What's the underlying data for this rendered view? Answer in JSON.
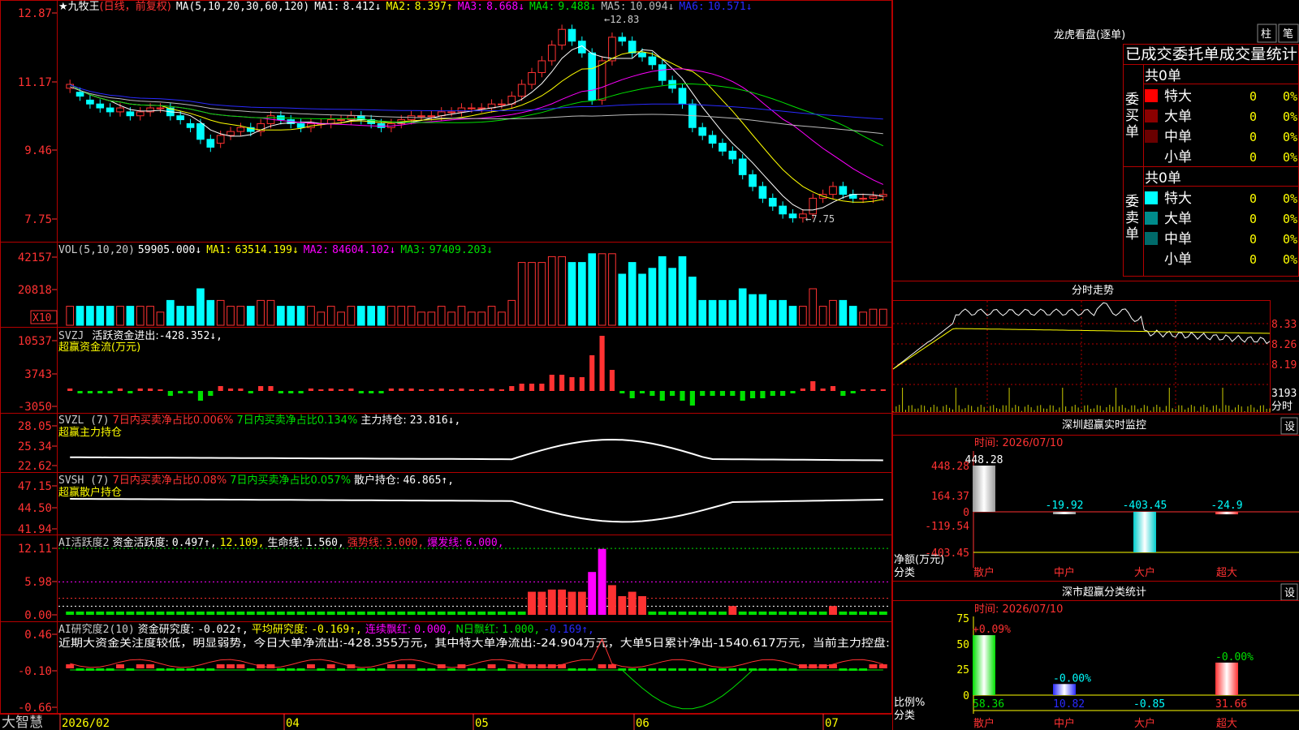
{
  "colors": {
    "up": "#ff3232",
    "down": "#00ffff",
    "green": "#00e000",
    "yellow": "#ffff00",
    "white": "#ffffff",
    "magenta": "#ff00ff",
    "blue": "#2a2aff",
    "grid": "#b40000",
    "axis": "#ff3232",
    "label": "#c0c0c0",
    "flat": "#00cccc"
  },
  "main": {
    "title": "★九牧王",
    "period": "(日线，前复权)",
    "ma_prefix": "MA(5,10,20,30,60,120)",
    "ma": [
      {
        "label": "MA1:",
        "value": "8.412↓",
        "color": "#ffffff"
      },
      {
        "label": "MA2:",
        "value": "8.397↑",
        "color": "#ffff00"
      },
      {
        "label": "MA3:",
        "value": "8.668↓",
        "color": "#ff00ff"
      },
      {
        "label": "MA4:",
        "value": "9.488↓",
        "color": "#00e000"
      },
      {
        "label": "MA5:",
        "value": "10.094↓",
        "color": "#bbbbbb"
      },
      {
        "label": "MA6:",
        "value": "10.571↓",
        "color": "#2a2aff"
      }
    ],
    "y_ticks": [
      "12.87",
      "11.17",
      "9.46",
      "7.75"
    ],
    "y_range": [
      7.4,
      13.1
    ],
    "high_marker": "←12.83",
    "low_marker": "←7.75"
  },
  "vol": {
    "title": "VOL(5,10,20)",
    "value": "59905.000↓",
    "ma": [
      {
        "label": "MA1:",
        "value": "63514.199↓",
        "color": "#ffff00"
      },
      {
        "label": "MA2:",
        "value": "84604.102↓",
        "color": "#ff00ff"
      },
      {
        "label": "MA3:",
        "value": "97409.203↓",
        "color": "#00e000"
      }
    ],
    "y_ticks": [
      "42157",
      "20818"
    ],
    "unit_box": "X10",
    "y_range": [
      0,
      50000
    ]
  },
  "svzj": {
    "title": "SVZJ",
    "label": "活跃资金进出:",
    "value": "-428.352↓,",
    "subtitle": "超赢资金流(万元)",
    "y_ticks": [
      "10537",
      "3743",
      "-3050"
    ],
    "y_range": [
      -3050,
      10537
    ]
  },
  "svzl": {
    "title": "SVZL (7)",
    "t1": "7日内买卖净占比0.006%",
    "t2": "7日内买卖净占比0.134%",
    "t3": "主力持仓:",
    "value": "23.816↓,",
    "subtitle": "超赢主力持仓",
    "y_ticks": [
      "28.05",
      "25.34",
      "22.62"
    ],
    "y_range": [
      22.62,
      28.05
    ]
  },
  "svsh": {
    "title": "SVSH (7)",
    "t1": "7日内买卖净占比0.08%",
    "t2": "7日内买卖净占比0.057%",
    "t3": "散户持仓:",
    "value": "46.865↑,",
    "subtitle": "超赢散户持仓",
    "y_ticks": [
      "47.15",
      "44.50",
      "41.94"
    ],
    "y_range": [
      41.94,
      47.15
    ]
  },
  "ai1": {
    "title": "AI活跃度2",
    "l1": "资金活跃度:",
    "v1": "0.497↑,",
    "v2": "12.109,",
    "l3": "生命线:",
    "v3": "1.560,",
    "l4": "强势线:",
    "v4": "3.000,",
    "l5": "爆发线:",
    "v5": "6.000,",
    "y_ticks": [
      "12.11",
      "5.98",
      "0.00"
    ],
    "y_range": [
      0,
      12.11
    ]
  },
  "ai2": {
    "title": "AI研究度2(10)",
    "l1": "资金研究度:",
    "v1": "-0.022↑,",
    "l2": "平均研究度:",
    "v2": "-0.169↑,",
    "l3": "连续飘红:",
    "v3": "0.000,",
    "l4": "N日飘红:",
    "v4": "1.000,",
    "v5": "-0.169↑,",
    "summary": "近期大资金关注度较低，明显弱势，今日大单净流出:-428.355万元，其中特大单净流出:-24.904万元，大单5日累计净出-1540.617万元，当前主力控盘:",
    "y_ticks": [
      "0.46",
      "-0.10",
      "-0.66"
    ],
    "y_range": [
      -0.66,
      0.46
    ]
  },
  "date_axis": [
    "2026/02",
    "04",
    "05",
    "06",
    "07"
  ],
  "brand": "大智慧",
  "chart_data": [
    {
      "type": "candlestick",
      "title": "★九牧王(日线，前复权)",
      "categories_note": "daily bars 2026/02 - 2026/07",
      "open": [
        11.1,
        11.0,
        10.8,
        10.7,
        10.6,
        10.5,
        10.5,
        10.4,
        10.5,
        10.6,
        10.6,
        10.4,
        10.2,
        10.2,
        9.8,
        9.7,
        9.9,
        10.0,
        10.1,
        10.0,
        10.2,
        10.4,
        10.3,
        10.2,
        10.1,
        10.2,
        10.2,
        10.3,
        10.3,
        10.4,
        10.3,
        10.2,
        10.1,
        10.2,
        10.3,
        10.4,
        10.4,
        10.4,
        10.5,
        10.5,
        10.6,
        10.6,
        10.6,
        10.7,
        10.7,
        10.9,
        11.2,
        11.5,
        11.8,
        12.2,
        12.6,
        12.3,
        12.0,
        10.8,
        11.8,
        12.4,
        12.3,
        12.0,
        11.9,
        11.7,
        11.3,
        11.1,
        10.7,
        10.1,
        9.9,
        9.7,
        9.5,
        9.3,
        8.9,
        8.6,
        8.3,
        8.1,
        7.9,
        7.8,
        7.9,
        8.3,
        8.4,
        8.6,
        8.4,
        8.3,
        8.3,
        8.35
      ],
      "close": [
        11.2,
        10.9,
        10.7,
        10.6,
        10.5,
        10.6,
        10.4,
        10.5,
        10.6,
        10.6,
        10.4,
        10.3,
        10.1,
        9.8,
        9.6,
        9.9,
        10.0,
        10.1,
        10.0,
        10.2,
        10.4,
        10.3,
        10.2,
        10.1,
        10.2,
        10.2,
        10.3,
        10.3,
        10.4,
        10.3,
        10.2,
        10.1,
        10.2,
        10.3,
        10.4,
        10.4,
        10.4,
        10.5,
        10.5,
        10.6,
        10.6,
        10.6,
        10.7,
        10.7,
        10.9,
        11.2,
        11.5,
        11.8,
        12.2,
        12.6,
        12.3,
        12.0,
        10.8,
        11.8,
        12.4,
        12.3,
        12.0,
        11.9,
        11.7,
        11.3,
        11.1,
        10.7,
        10.1,
        9.9,
        9.7,
        9.5,
        9.3,
        8.9,
        8.6,
        8.3,
        8.1,
        7.9,
        7.8,
        7.9,
        8.3,
        8.4,
        8.6,
        8.4,
        8.3,
        8.3,
        8.35,
        8.4
      ]
    }
  ],
  "right": {
    "dragon_title": "龙虎看盘(逐单)",
    "btn_bar": "柱",
    "btn_pen": "笔",
    "tabs": "已成交委托单成交量统计",
    "buy": {
      "side_label": "委买单",
      "total": "共0单",
      "rows": [
        {
          "name": "特大",
          "count": "0",
          "pct": "0%",
          "color": "#ff0000"
        },
        {
          "name": "大单",
          "count": "0",
          "pct": "0%",
          "color": "#8b0000"
        },
        {
          "name": "中单",
          "count": "0",
          "pct": "0%",
          "color": "#6a0000"
        },
        {
          "name": "小单",
          "count": "0",
          "pct": "0%",
          "color": ""
        }
      ]
    },
    "sell": {
      "side_label": "委卖单",
      "total": "共0单",
      "rows": [
        {
          "name": "特大",
          "count": "0",
          "pct": "0%",
          "color": "#00ffff"
        },
        {
          "name": "大单",
          "count": "0",
          "pct": "0%",
          "color": "#008b8b"
        },
        {
          "name": "中单",
          "count": "0",
          "pct": "0%",
          "color": "#006a6a"
        },
        {
          "name": "小单",
          "count": "0",
          "pct": "0%",
          "color": ""
        }
      ]
    },
    "intraday": {
      "title": "分时走势",
      "y_ticks": [
        "8.33",
        "8.26",
        "8.19"
      ],
      "vol_tick": "3193",
      "vol_label": "分时"
    },
    "sz_monitor": {
      "title": "深圳超赢实时监控",
      "settings": "设",
      "time": "时间: 2026/07/10",
      "y_ticks": [
        "448.28",
        "164.37",
        "0",
        "-119.54",
        "-403.45"
      ],
      "y_label": "净额(万元)",
      "x_label": "分类",
      "categories": [
        "散户",
        "中户",
        "大户",
        "超大"
      ],
      "values": [
        448.28,
        -19.92,
        -403.45,
        -24.9
      ],
      "value_labels": [
        "448.28",
        "-19.92",
        "-403.45",
        "-24.9"
      ]
    },
    "sz_class": {
      "title": "深市超赢分类统计",
      "settings": "设",
      "time": "时间: 2026/07/10",
      "y_ticks": [
        "75",
        "50",
        "25",
        "0"
      ],
      "y_label": "比例%",
      "x_label": "分类",
      "categories": [
        "散户",
        "中户",
        "大户",
        "超大"
      ],
      "values": [
        58.36,
        10.82,
        -0.85,
        31.66
      ],
      "top_labels": [
        "+0.09%",
        "-0.00%",
        "",
        "-0.00%"
      ],
      "bottom_labels": [
        "58.36",
        "10.82",
        "-0.85",
        "31.66"
      ],
      "bottom_colors": [
        "#00e000",
        "#2a2aff",
        "#00ffff",
        "#ff3232"
      ]
    }
  }
}
